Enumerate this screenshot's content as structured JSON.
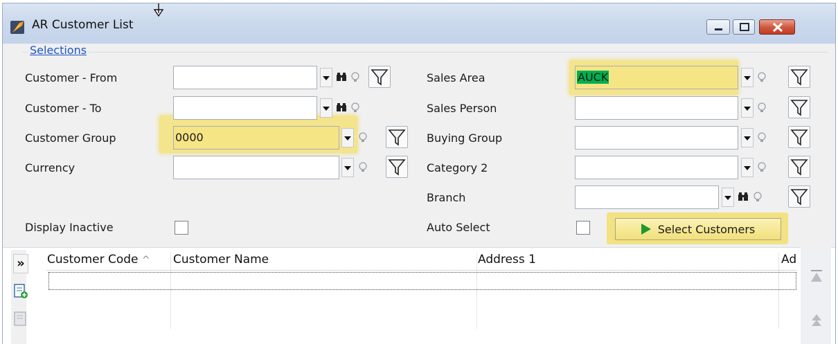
{
  "window": {
    "title": "AR Customer List"
  },
  "selections": {
    "group_label": "Selections",
    "customer_from": {
      "label": "Customer - From",
      "value": ""
    },
    "customer_to": {
      "label": "Customer - To",
      "value": ""
    },
    "customer_group": {
      "label": "Customer Group",
      "value": "0000"
    },
    "currency": {
      "label": "Currency",
      "value": ""
    },
    "display_inactive": {
      "label": "Display Inactive",
      "checked": false
    },
    "sales_area": {
      "label": "Sales Area",
      "value": "AUCK"
    },
    "sales_person": {
      "label": "Sales Person",
      "value": ""
    },
    "buying_group": {
      "label": "Buying Group",
      "value": ""
    },
    "category_2": {
      "label": "Category 2",
      "value": ""
    },
    "branch": {
      "label": "Branch",
      "value": ""
    },
    "auto_select": {
      "label": "Auto Select",
      "checked": false
    },
    "select_button_label": "Select Customers"
  },
  "grid": {
    "expand_label": "»",
    "columns": [
      "Customer Code",
      "Customer Name",
      "Address 1",
      "Ad"
    ],
    "sort_indicator": "^"
  },
  "colors": {
    "highlight": "#f5e27a",
    "link_blue": "#1c55c8",
    "selection_green": "#00b050"
  }
}
